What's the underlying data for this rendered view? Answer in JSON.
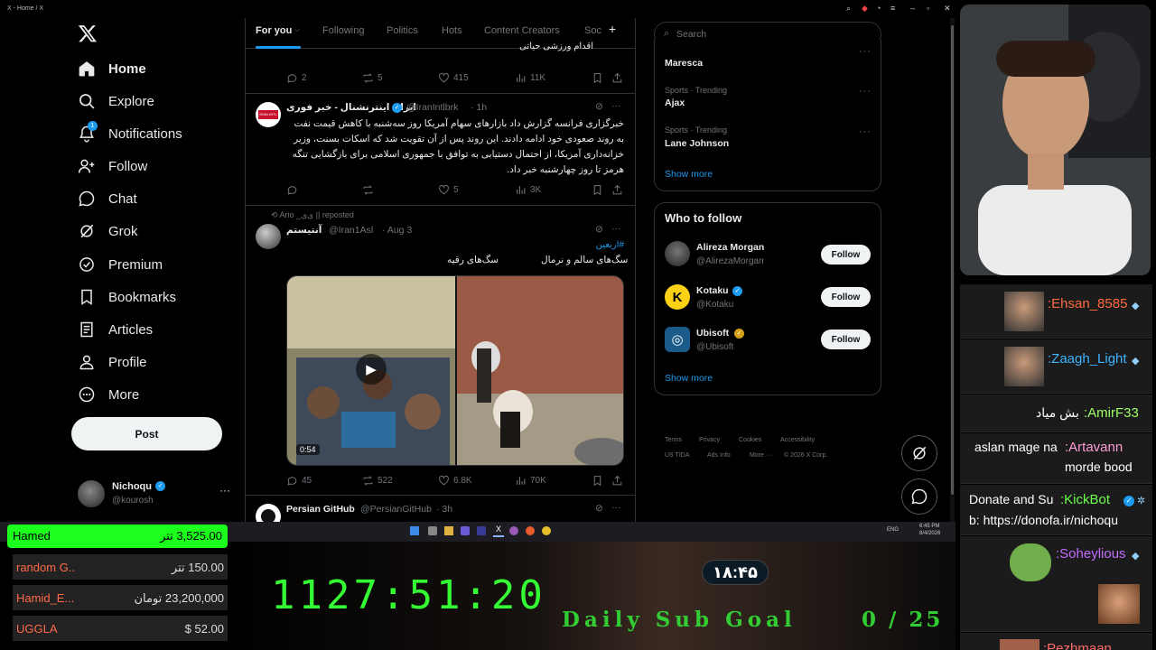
{
  "window": {
    "title": "X - Home / X"
  },
  "nav": {
    "items": [
      {
        "label": "Home",
        "icon": "home-icon"
      },
      {
        "label": "Explore",
        "icon": "search-icon"
      },
      {
        "label": "Notifications",
        "icon": "bell-icon",
        "badge": "1"
      },
      {
        "label": "Follow",
        "icon": "person-add-icon"
      },
      {
        "label": "Chat",
        "icon": "chat-icon"
      },
      {
        "label": "Grok",
        "icon": "grok-icon"
      },
      {
        "label": "Premium",
        "icon": "premium-icon"
      },
      {
        "label": "Bookmarks",
        "icon": "bookmark-icon"
      },
      {
        "label": "Articles",
        "icon": "article-icon"
      },
      {
        "label": "Profile",
        "icon": "person-icon"
      },
      {
        "label": "More",
        "icon": "more-circle-icon"
      }
    ],
    "post_label": "Post",
    "account": {
      "name": "Nichoqu",
      "handle": "@kourosh"
    }
  },
  "tabs": [
    "For you",
    "Following",
    "Politics",
    "Hots",
    "Content Creators",
    "Soc"
  ],
  "feed": {
    "top_fragment": "اقدام ورزشی حیاتی",
    "post0_stats": {
      "replies": "2",
      "reposts": "5",
      "likes": "415",
      "views": "11K"
    },
    "post1": {
      "name": "ایران اینترنشنال - خبر فوری",
      "handle": "@IranIntlbrk",
      "time": "· 1h",
      "text": "خبرگزاری فرانسه گزارش داد بازارهای سهام آمریکا روز سه‌شنبه با کاهش قیمت نفت به روند صعودی خود ادامه دادند. این روند پس از آن تقویت شد که اسکات بسنت، وزیر خزانه‌داری آمریکا، از احتمال دستیابی به توافق با جمهوری اسلامی برای بازگشایی تنگه هرمز تا روز چهارشنبه خبر داد.",
      "avatar_text": "IRAN INTL",
      "stats": {
        "replies": "",
        "reposts": "",
        "likes": "5",
        "views": "3K"
      }
    },
    "post2": {
      "repost_line": "Ario _ی‌ی || reposted",
      "name": "آنتیستم",
      "handle": "@Iran1Asl",
      "time": "· Aug 3",
      "hashtag": "#اربعین",
      "caption_right": "سگ‌های سالم و نرمال",
      "caption_left": "سگ‌های رقیه",
      "duration": "0:54",
      "stats": {
        "replies": "45",
        "reposts": "522",
        "likes": "6.8K",
        "views": "70K"
      }
    },
    "post3": {
      "name": "Persian GitHub",
      "handle": "@PersianGitHub",
      "time": "· 3h"
    }
  },
  "right": {
    "search_placeholder": "Search",
    "trends": [
      {
        "category": "",
        "name": "Maresca"
      },
      {
        "category": "Sports · Trending",
        "name": "Ajax"
      },
      {
        "category": "Sports · Trending",
        "name": "Lane Johnson"
      }
    ],
    "show_more": "Show more",
    "who_to_follow_title": "Who to follow",
    "suggestions": [
      {
        "name": "Alireza Morgan",
        "handle": "@AlirezaMorgan",
        "verified": false
      },
      {
        "name": "Kotaku",
        "handle": "@Kotaku",
        "verified": true
      },
      {
        "name": "Ubisoft",
        "handle": "@Ubisoft",
        "verified": true
      }
    ],
    "follow_label": "Follow",
    "footer": [
      "Terms",
      "Privacy",
      "Cookies",
      "Accessibility",
      "US TIDA",
      "Ads Info",
      "More ···",
      "© 2026 X Corp."
    ]
  },
  "chat": [
    {
      "user": ":Ehsan_8585",
      "msg": "",
      "color": "#ff6a3d"
    },
    {
      "user": ":Zaagh_Light",
      "msg": "",
      "color": "#3db4ff"
    },
    {
      "user": ":AmirF33",
      "msg": "بش میاد",
      "color": "#9dff6a"
    },
    {
      "user": ":Artavann",
      "msg": "aslan mage na",
      "msg2": "morde bood",
      "color": "#ff9dd2"
    },
    {
      "user": ":KickBot",
      "msg": "Donate and Su",
      "msg2": "b: https://donofa.ir/nichoqu",
      "color": "#6aff4a"
    },
    {
      "user": ":Soheylious",
      "msg": "",
      "color": "#c26bff"
    },
    {
      "user": ":Pezhmaan",
      "msg": "",
      "color": "#ff6a6a"
    }
  ],
  "donors": [
    {
      "name": "Hamed",
      "amount": "3,525.00 تتر"
    },
    {
      "name": "random G..",
      "amount": "150.00 تتر"
    },
    {
      "name": "Hamid_E...",
      "amount": "23,200,000 تومان"
    },
    {
      "name": "UGGLA",
      "amount": "$ 52.00"
    }
  ],
  "stream": {
    "timer": "1127:51:20",
    "clock": "۱۸:۴۵",
    "goal_label": "Daily Sub Goal",
    "goal_count": "0 / 25"
  },
  "taskbar": {
    "time": "6:45 PM",
    "date": "8/4/2026",
    "lang": "ENG"
  }
}
